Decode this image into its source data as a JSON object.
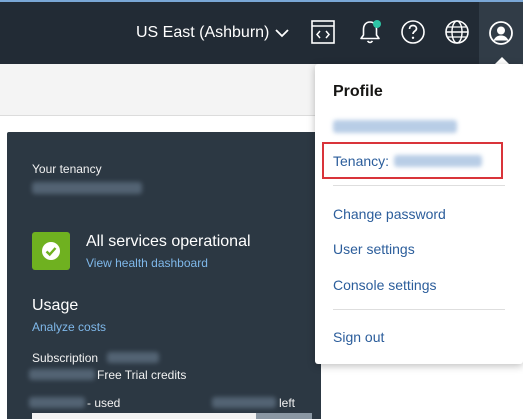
{
  "header": {
    "region_label": "US East (Ashburn)",
    "icons": [
      "chevron-down-icon",
      "code-editor-icon",
      "bell-icon",
      "help-icon",
      "globe-icon",
      "user-icon"
    ],
    "notification_dot_color": "#2ec5a5"
  },
  "card": {
    "tenancy_label": "Your tenancy",
    "status_title": "All services operational",
    "status_link": "View health dashboard",
    "status_color": "#6fb120",
    "usage_title": "Usage",
    "usage_link": "Analyze costs",
    "subscription_label": "Subscription",
    "credits_label": "Free Trial credits",
    "used_label": "- used",
    "left_label": "left",
    "usage_fraction": 0.8
  },
  "profile_menu": {
    "title": "Profile",
    "tenancy_prefix": "Tenancy:",
    "highlight_color": "#d9343a",
    "items": {
      "change_password": "Change password",
      "user_settings": "User settings",
      "console_settings": "Console settings",
      "sign_out": "Sign out"
    }
  }
}
